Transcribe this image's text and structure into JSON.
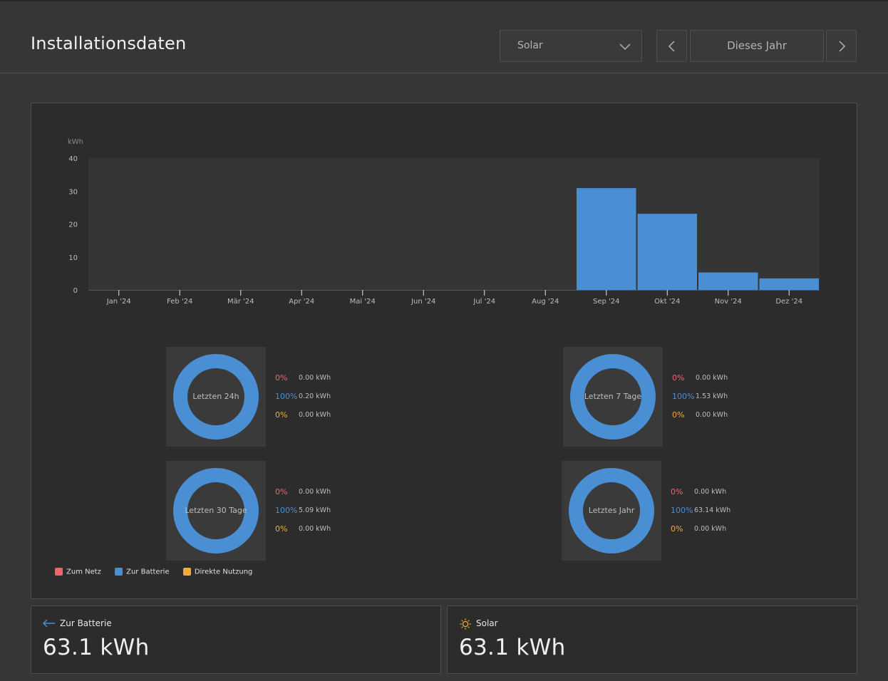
{
  "header": {
    "title": "Installationsdaten",
    "source_select": {
      "value": "Solar"
    },
    "period": "Dieses Jahr"
  },
  "chart_data": {
    "type": "bar",
    "ylabel": "kWh",
    "ylim": [
      0,
      40
    ],
    "yticks": [
      "0",
      "10",
      "20",
      "30",
      "40"
    ],
    "categories": [
      "Jan '24",
      "Feb '24",
      "Mär '24",
      "Apr '24",
      "Mai '24",
      "Jun '24",
      "Jul '24",
      "Aug '24",
      "Sep '24",
      "Okt '24",
      "Nov '24",
      "Dez '24"
    ],
    "values": [
      0,
      0,
      0,
      0,
      0,
      0,
      0,
      0,
      30.9,
      23.1,
      5.3,
      3.5
    ],
    "bar_color": "#4a8fd4",
    "plot_bg": "#353535",
    "grid": false
  },
  "donuts": [
    {
      "label": "Letzten 24h",
      "stats": [
        {
          "pct": "0%",
          "kwh": "0.00 kWh"
        },
        {
          "pct": "100%",
          "kwh": "0.20 kWh"
        },
        {
          "pct": "0%",
          "kwh": "0.00 kWh"
        }
      ]
    },
    {
      "label": "Letzten 7 Tage",
      "stats": [
        {
          "pct": "0%",
          "kwh": "0.00 kWh"
        },
        {
          "pct": "100%",
          "kwh": "1.53 kWh"
        },
        {
          "pct": "0%",
          "kwh": "0.00 kWh"
        }
      ]
    },
    {
      "label": "Letzten 30 Tage",
      "stats": [
        {
          "pct": "0%",
          "kwh": "0.00 kWh"
        },
        {
          "pct": "100%",
          "kwh": "5.09 kWh"
        },
        {
          "pct": "0%",
          "kwh": "0.00 kWh"
        }
      ]
    },
    {
      "label": "Letztes Jahr",
      "stats": [
        {
          "pct": "0%",
          "kwh": "0.00 kWh"
        },
        {
          "pct": "100%",
          "kwh": "63.14 kWh"
        },
        {
          "pct": "0%",
          "kwh": "0.00 kWh"
        }
      ]
    }
  ],
  "legend": [
    {
      "label": "Zum Netz",
      "color": "#f0636b"
    },
    {
      "label": "Zur Batterie",
      "color": "#4a8fd4"
    },
    {
      "label": "Direkte Nutzung",
      "color": "#f4a93b"
    }
  ],
  "stat_colors": [
    "#f0636b",
    "#4a8fd4",
    "#f4a93b"
  ],
  "cards": [
    {
      "label": "Zur Batterie",
      "value": "63.1 kWh",
      "icon": "arrow-left-icon",
      "icon_color": "#4a8fd4"
    },
    {
      "label": "Solar",
      "value": "63.1 kWh",
      "icon": "sun-icon",
      "icon_color": "#f4a93b"
    }
  ]
}
